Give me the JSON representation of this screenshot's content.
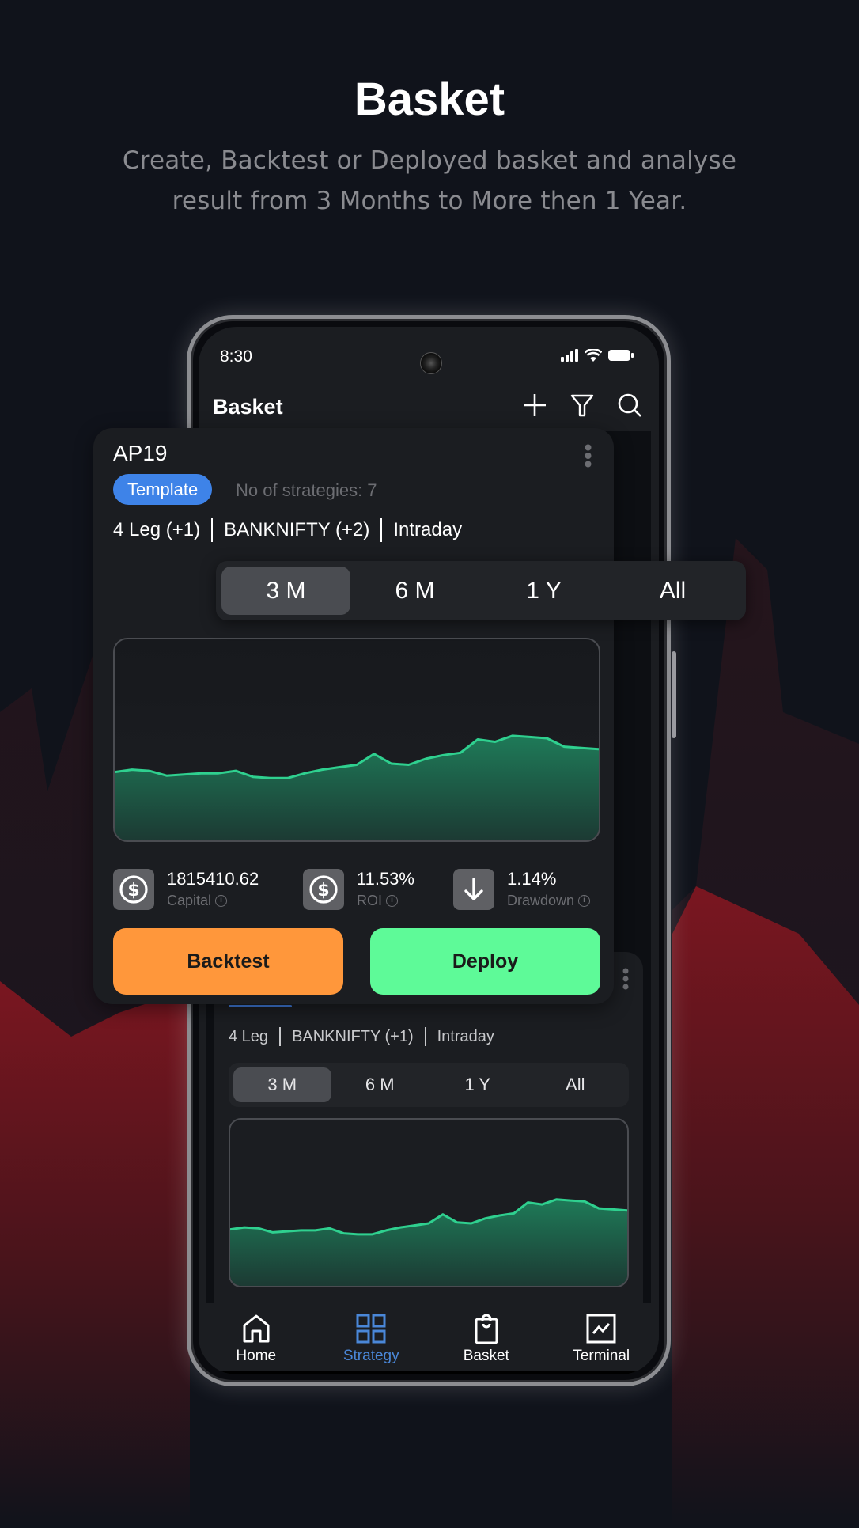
{
  "hero": {
    "title": "Basket",
    "subtitle": "Create, Backtest or Deployed basket and analyse result from 3 Months to More then 1 Year."
  },
  "status_bar": {
    "time": "8:30",
    "icons": [
      "signal-icon",
      "wifi-icon",
      "battery-icon"
    ]
  },
  "app_header": {
    "title": "Basket",
    "actions": [
      "plus-icon",
      "filter-icon",
      "search-icon"
    ]
  },
  "featured_card": {
    "name": "AP19",
    "badge": "Template",
    "strategies_count": "No of strategies: 7",
    "meta": [
      "4 Leg (+1)",
      "BANKNIFTY (+2)",
      "Intraday"
    ],
    "range_tabs": [
      "3 M",
      "6 M",
      "1 Y",
      "All"
    ],
    "active_range": "3 M",
    "stats": [
      {
        "icon": "dollar-icon",
        "value": "1815410.62",
        "label": "Capital"
      },
      {
        "icon": "dollar-icon",
        "value": "11.53%",
        "label": "ROI"
      },
      {
        "icon": "arrow-down-icon",
        "value": "1.14%",
        "label": "Drawdown"
      }
    ],
    "buttons": {
      "backtest": "Backtest",
      "deploy": "Deploy"
    },
    "chart_series": [
      45,
      47,
      46,
      42,
      43,
      44,
      44,
      46,
      41,
      40,
      40,
      44,
      47,
      49,
      51,
      60,
      52,
      51,
      56,
      59,
      61,
      72,
      70,
      75,
      74,
      73,
      66,
      65,
      64
    ]
  },
  "second_card": {
    "meta": [
      "4 Leg",
      "BANKNIFTY (+1)",
      "Intraday"
    ],
    "range_tabs": [
      "3 M",
      "6 M",
      "1 Y",
      "All"
    ],
    "active_range": "3 M",
    "chart_series": [
      45,
      47,
      46,
      42,
      43,
      44,
      44,
      46,
      41,
      40,
      40,
      44,
      47,
      49,
      51,
      60,
      52,
      51,
      56,
      59,
      61,
      72,
      70,
      75,
      74,
      73,
      66,
      65,
      64
    ]
  },
  "bottom_nav": {
    "items": [
      {
        "label": "Home",
        "icon": "home-icon",
        "active": false
      },
      {
        "label": "Strategy",
        "icon": "grid-icon",
        "active": true
      },
      {
        "label": "Basket",
        "icon": "shopping-bag-icon",
        "active": false
      },
      {
        "label": "Terminal",
        "icon": "chart-icon",
        "active": false
      }
    ]
  },
  "colors": {
    "accent_blue": "#3e83e8",
    "backtest_orange": "#ff973b",
    "deploy_green": "#5efa98",
    "chart_line": "#2fd08f",
    "chart_fill": "#1e7a58",
    "nav_active": "#4a87d8"
  }
}
